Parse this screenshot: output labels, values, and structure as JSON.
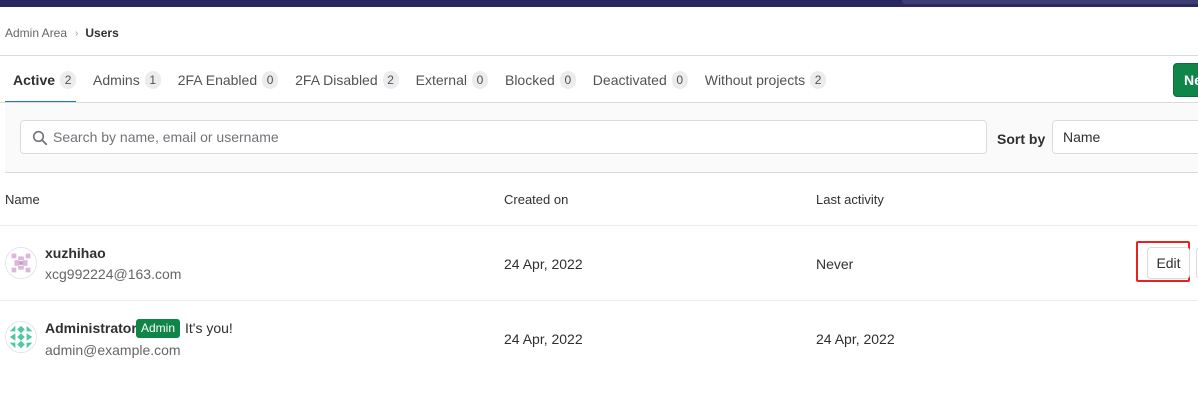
{
  "breadcrumb": {
    "parent": "Admin Area",
    "separator": "›",
    "current": "Users"
  },
  "tabs": [
    {
      "label": "Active",
      "count": "2",
      "active": true
    },
    {
      "label": "Admins",
      "count": "1"
    },
    {
      "label": "2FA Enabled",
      "count": "0"
    },
    {
      "label": "2FA Disabled",
      "count": "2"
    },
    {
      "label": "External",
      "count": "0"
    },
    {
      "label": "Blocked",
      "count": "0"
    },
    {
      "label": "Deactivated",
      "count": "0"
    },
    {
      "label": "Without projects",
      "count": "2"
    }
  ],
  "new_user_button": {
    "label": "New user"
  },
  "search": {
    "placeholder": "Search by name, email or username",
    "icon": "search-icon"
  },
  "sort": {
    "label": "Sort by",
    "value": "Name"
  },
  "table": {
    "headers": {
      "name": "Name",
      "created": "Created on",
      "activity": "Last activity"
    },
    "rows": [
      {
        "name": "xuzhihao",
        "email": "xcg992224@163.com",
        "created": "24 Apr, 2022",
        "activity": "Never",
        "edit_label": "Edit"
      },
      {
        "name": "Administrator",
        "badge": "Admin",
        "note": "It's you!",
        "email": "admin@example.com",
        "created": "24 Apr, 2022",
        "activity": "24 Apr, 2022"
      }
    ]
  },
  "colors": {
    "accent": "#1f75cb",
    "success": "#108548",
    "highlight": "#e8231f",
    "topbar": "#292961"
  }
}
